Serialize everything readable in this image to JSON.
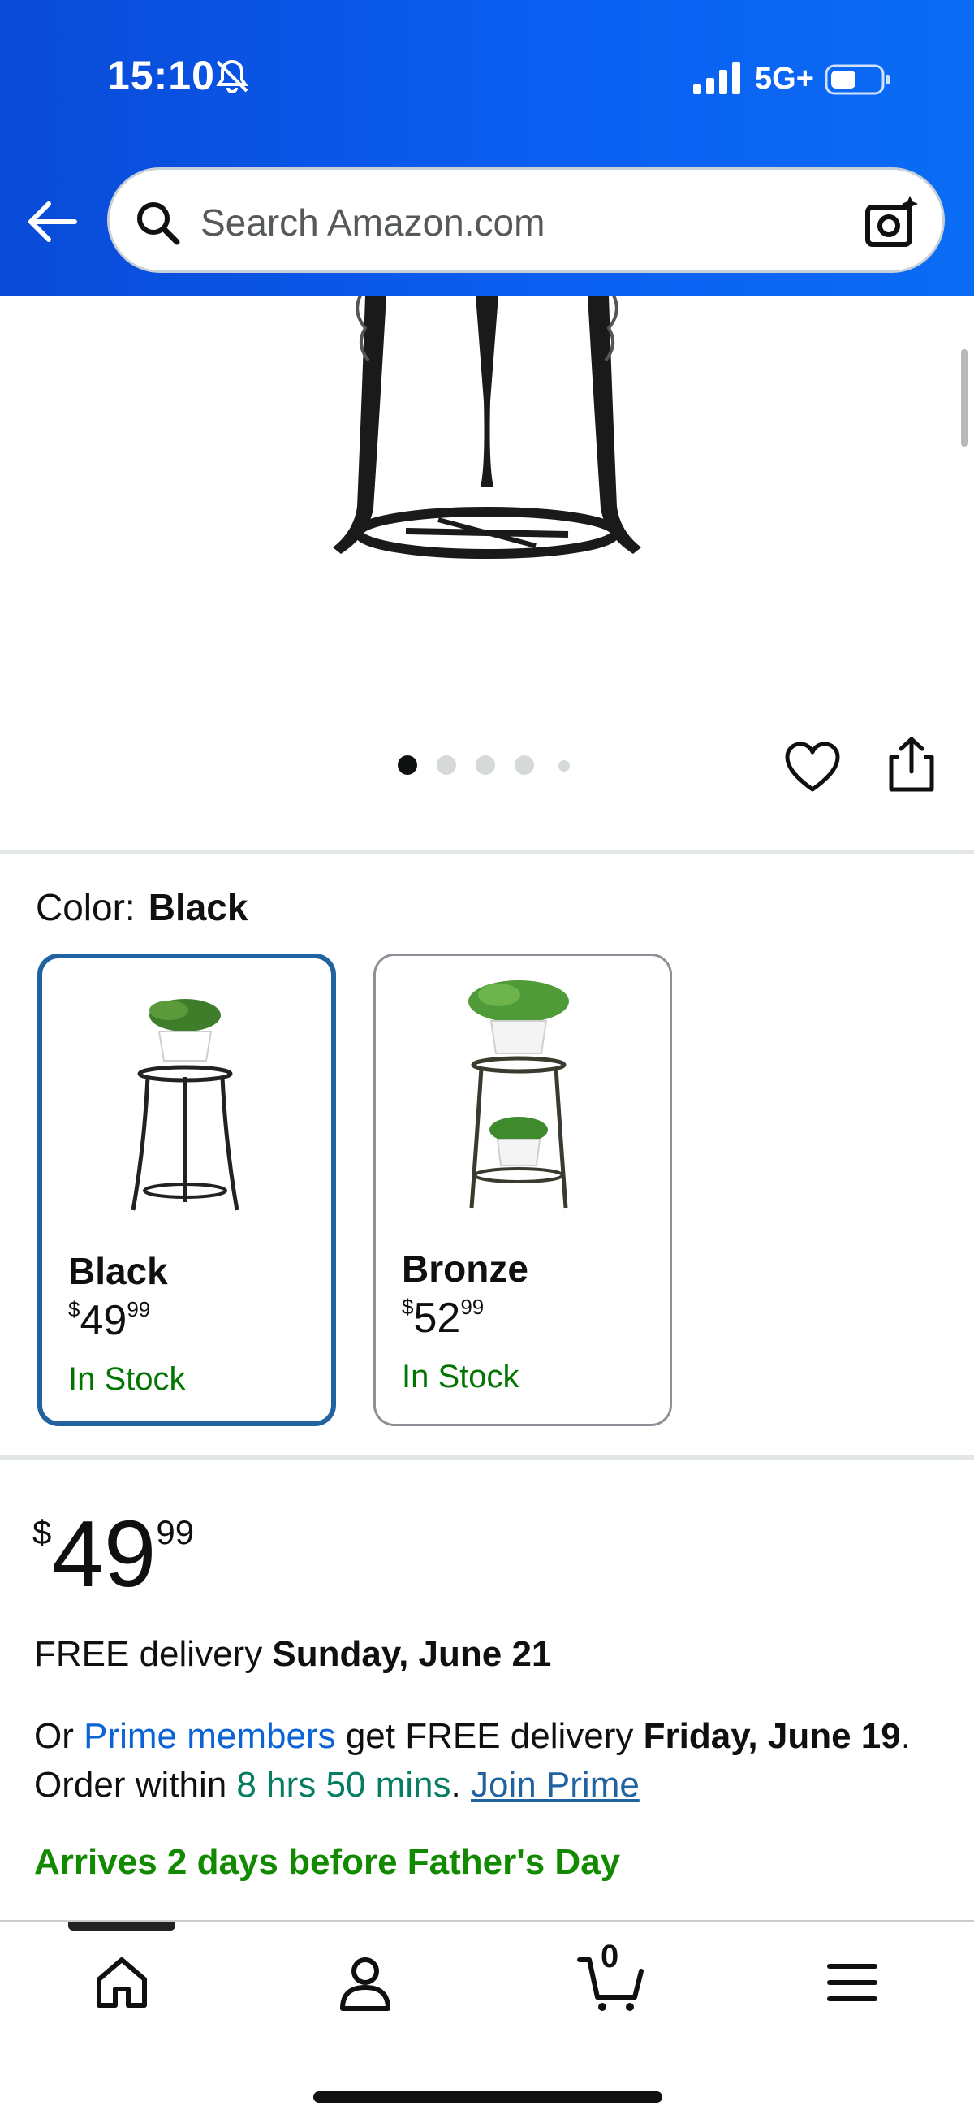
{
  "status_bar": {
    "time": "15:10",
    "network": "5G+"
  },
  "search": {
    "placeholder": "Search Amazon.com"
  },
  "gallery": {
    "image_count": 5,
    "active_index": 0
  },
  "color_selector": {
    "label": "Color:",
    "selected": "Black",
    "options": [
      {
        "name": "Black",
        "price_symbol": "$",
        "price_whole": "49",
        "price_fraction": "99",
        "stock": "In Stock"
      },
      {
        "name": "Bronze",
        "price_symbol": "$",
        "price_whole": "52",
        "price_fraction": "99",
        "stock": "In Stock"
      }
    ]
  },
  "price": {
    "symbol": "$",
    "whole": "49",
    "fraction": "99"
  },
  "delivery": {
    "prefix": "FREE delivery ",
    "date": "Sunday, June 21"
  },
  "prime_offer": {
    "part1": "Or ",
    "prime_link": "Prime members",
    "part2": " get FREE delivery ",
    "date": "Friday, June 19",
    "part3": ". Order within ",
    "countdown": "8 hrs 50 mins",
    "part4": ". ",
    "join_link": "Join Prime"
  },
  "arrives_note": "Arrives 2 days before Father's Day",
  "bottom_nav": {
    "cart_count": "0"
  },
  "colors": {
    "header_blue": "#0a5ef0",
    "selected_border": "#2162a1",
    "stock_green": "#007600",
    "link_blue": "#0b63d6",
    "arrives_green": "#118a00"
  }
}
